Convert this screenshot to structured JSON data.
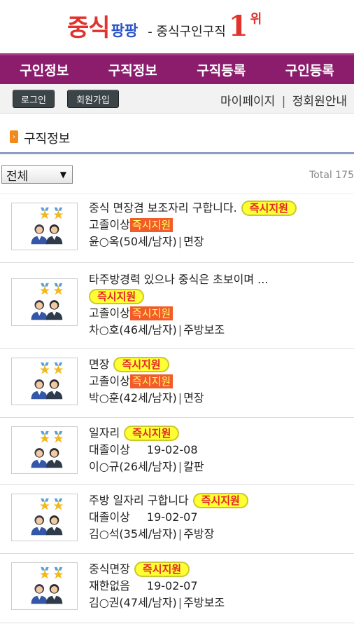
{
  "header": {
    "logo_main": "중식",
    "logo_sub": "팡팡",
    "tagline": "- 중식구인구직",
    "rank_num": "1",
    "rank_unit": "위"
  },
  "nav": [
    "구인정보",
    "구직정보",
    "구직등록",
    "구인등록"
  ],
  "login_bar": {
    "login": "로그인",
    "join": "회원가입",
    "mypage": "마이페이지",
    "separator": "|",
    "membership": "정회원안내"
  },
  "section": {
    "title": "구직정보",
    "icon": "arrow-right-icon"
  },
  "filter": {
    "selected": "전체",
    "total": "Total 175"
  },
  "items": [
    {
      "title": "중식 면장겸 보조자리 구합니다.",
      "badge": "즉시지원",
      "education": "고졸이상",
      "tag": "즉시지원",
      "person": "윤○옥(50세/남자)",
      "sep": "|",
      "position": "면장"
    },
    {
      "title": "타주방경력 있으나 중식은 초보이며 ...",
      "badge": "즉시지원",
      "education": "고졸이상",
      "tag": "즉시지원",
      "person": "차○호(46세/남자)",
      "sep": "|",
      "position": "주방보조"
    },
    {
      "title": "면장",
      "badge": "즉시지원",
      "education": "고졸이상",
      "tag": "즉시지원",
      "person": "박○훈(42세/남자)",
      "sep": "|",
      "position": "면장"
    },
    {
      "title": "일자리",
      "badge": "즉시지원",
      "education": "대졸이상",
      "date": "19-02-08",
      "person": "이○규(26세/남자)",
      "sep": "|",
      "position": "칼판"
    },
    {
      "title": "주방 일자리 구합니다",
      "badge": "즉시지원",
      "education": "대졸이상",
      "date": "19-02-07",
      "person": "김○석(35세/남자)",
      "sep": "|",
      "position": "주방장"
    },
    {
      "title": "중식면장",
      "badge": "즉시지원",
      "education": "재한없음",
      "date": "19-02-07",
      "person": "김○권(47세/남자)",
      "sep": "|",
      "position": "주방보조"
    }
  ],
  "colors": {
    "brand": "#8c1d6d",
    "logo_red": "#e1322d",
    "logo_blue": "#2a55c8",
    "badge_yellow": "#ffff33",
    "tag_orange": "#f25c2a"
  },
  "icons": {
    "thumbnail": "people-medal-icon"
  }
}
